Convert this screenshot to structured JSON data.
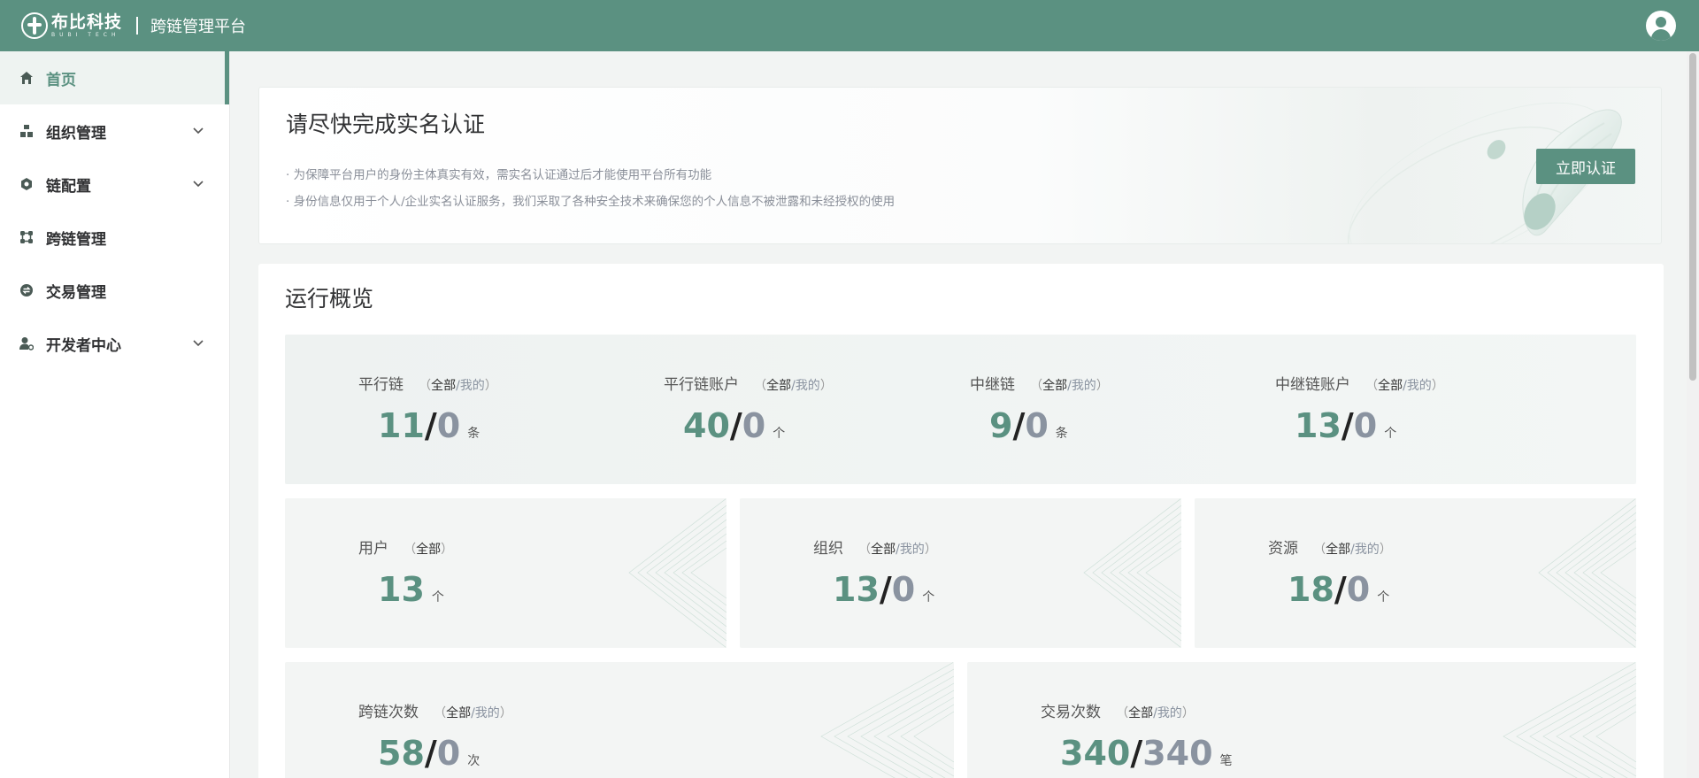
{
  "header": {
    "logo_name": "布比科技",
    "logo_sub": "BUBI TECH",
    "platform_title": "跨链管理平台"
  },
  "sidebar": {
    "items": [
      {
        "label": "首页",
        "icon": "home-icon",
        "active": true
      },
      {
        "label": "组织管理",
        "icon": "org-icon",
        "expandable": true
      },
      {
        "label": "链配置",
        "icon": "chain-config-icon",
        "expandable": true
      },
      {
        "label": "跨链管理",
        "icon": "crosschain-icon"
      },
      {
        "label": "交易管理",
        "icon": "transaction-icon"
      },
      {
        "label": "开发者中心",
        "icon": "developer-icon",
        "expandable": true
      }
    ]
  },
  "notice": {
    "title": "请尽快完成实名认证",
    "line1": "· 为保障平台用户的身份主体真实有效，需实名认证通过后才能使用平台所有功能",
    "line2": "· 身份信息仅用于个人/企业实名认证服务，我们采取了各种安全技术来确保您的个人信息不被泄露和未经授权的使用",
    "button": "立即认证"
  },
  "overview": {
    "title": "运行概览",
    "scope_all": "全部",
    "scope_sep": "/",
    "scope_mine": "我的",
    "paren_open": "（",
    "paren_close": "）",
    "stats": {
      "parallel_chain": {
        "label": "平行链",
        "all": "11",
        "mine": "0",
        "unit": "条"
      },
      "parallel_account": {
        "label": "平行链账户",
        "all": "40",
        "mine": "0",
        "unit": "个"
      },
      "relay_chain": {
        "label": "中继链",
        "all": "9",
        "mine": "0",
        "unit": "条"
      },
      "relay_account": {
        "label": "中继链账户",
        "all": "13",
        "mine": "0",
        "unit": "个"
      },
      "users": {
        "label": "用户",
        "all": "13",
        "unit": "个"
      },
      "orgs": {
        "label": "组织",
        "all": "13",
        "mine": "0",
        "unit": "个"
      },
      "resources": {
        "label": "资源",
        "all": "18",
        "mine": "0",
        "unit": "个"
      },
      "crosschain_count": {
        "label": "跨链次数",
        "all": "58",
        "mine": "0",
        "unit": "次"
      },
      "tx_count": {
        "label": "交易次数",
        "all": "340",
        "mine": "340",
        "unit": "笔"
      }
    },
    "value_sep": "/"
  },
  "colors": {
    "brand": "#5b9181",
    "mine_value": "#8a93a0"
  }
}
